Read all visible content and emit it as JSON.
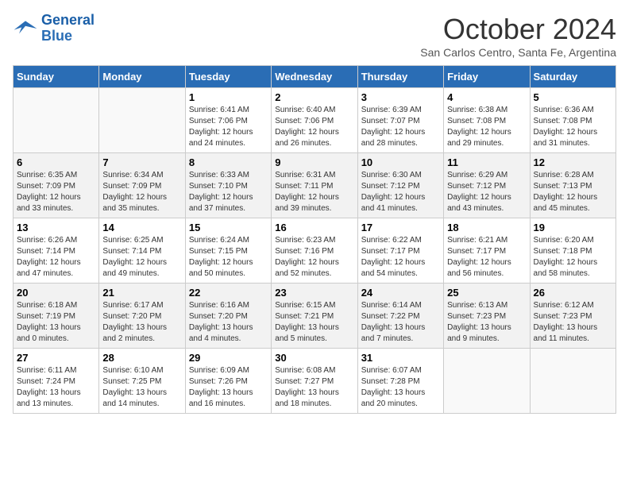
{
  "header": {
    "logo_line1": "General",
    "logo_line2": "Blue",
    "month_title": "October 2024",
    "location": "San Carlos Centro, Santa Fe, Argentina"
  },
  "days_of_week": [
    "Sunday",
    "Monday",
    "Tuesday",
    "Wednesday",
    "Thursday",
    "Friday",
    "Saturday"
  ],
  "weeks": [
    [
      {
        "day": "",
        "info": ""
      },
      {
        "day": "",
        "info": ""
      },
      {
        "day": "1",
        "info": "Sunrise: 6:41 AM\nSunset: 7:06 PM\nDaylight: 12 hours and 24 minutes."
      },
      {
        "day": "2",
        "info": "Sunrise: 6:40 AM\nSunset: 7:06 PM\nDaylight: 12 hours and 26 minutes."
      },
      {
        "day": "3",
        "info": "Sunrise: 6:39 AM\nSunset: 7:07 PM\nDaylight: 12 hours and 28 minutes."
      },
      {
        "day": "4",
        "info": "Sunrise: 6:38 AM\nSunset: 7:08 PM\nDaylight: 12 hours and 29 minutes."
      },
      {
        "day": "5",
        "info": "Sunrise: 6:36 AM\nSunset: 7:08 PM\nDaylight: 12 hours and 31 minutes."
      }
    ],
    [
      {
        "day": "6",
        "info": "Sunrise: 6:35 AM\nSunset: 7:09 PM\nDaylight: 12 hours and 33 minutes."
      },
      {
        "day": "7",
        "info": "Sunrise: 6:34 AM\nSunset: 7:09 PM\nDaylight: 12 hours and 35 minutes."
      },
      {
        "day": "8",
        "info": "Sunrise: 6:33 AM\nSunset: 7:10 PM\nDaylight: 12 hours and 37 minutes."
      },
      {
        "day": "9",
        "info": "Sunrise: 6:31 AM\nSunset: 7:11 PM\nDaylight: 12 hours and 39 minutes."
      },
      {
        "day": "10",
        "info": "Sunrise: 6:30 AM\nSunset: 7:12 PM\nDaylight: 12 hours and 41 minutes."
      },
      {
        "day": "11",
        "info": "Sunrise: 6:29 AM\nSunset: 7:12 PM\nDaylight: 12 hours and 43 minutes."
      },
      {
        "day": "12",
        "info": "Sunrise: 6:28 AM\nSunset: 7:13 PM\nDaylight: 12 hours and 45 minutes."
      }
    ],
    [
      {
        "day": "13",
        "info": "Sunrise: 6:26 AM\nSunset: 7:14 PM\nDaylight: 12 hours and 47 minutes."
      },
      {
        "day": "14",
        "info": "Sunrise: 6:25 AM\nSunset: 7:14 PM\nDaylight: 12 hours and 49 minutes."
      },
      {
        "day": "15",
        "info": "Sunrise: 6:24 AM\nSunset: 7:15 PM\nDaylight: 12 hours and 50 minutes."
      },
      {
        "day": "16",
        "info": "Sunrise: 6:23 AM\nSunset: 7:16 PM\nDaylight: 12 hours and 52 minutes."
      },
      {
        "day": "17",
        "info": "Sunrise: 6:22 AM\nSunset: 7:17 PM\nDaylight: 12 hours and 54 minutes."
      },
      {
        "day": "18",
        "info": "Sunrise: 6:21 AM\nSunset: 7:17 PM\nDaylight: 12 hours and 56 minutes."
      },
      {
        "day": "19",
        "info": "Sunrise: 6:20 AM\nSunset: 7:18 PM\nDaylight: 12 hours and 58 minutes."
      }
    ],
    [
      {
        "day": "20",
        "info": "Sunrise: 6:18 AM\nSunset: 7:19 PM\nDaylight: 13 hours and 0 minutes."
      },
      {
        "day": "21",
        "info": "Sunrise: 6:17 AM\nSunset: 7:20 PM\nDaylight: 13 hours and 2 minutes."
      },
      {
        "day": "22",
        "info": "Sunrise: 6:16 AM\nSunset: 7:20 PM\nDaylight: 13 hours and 4 minutes."
      },
      {
        "day": "23",
        "info": "Sunrise: 6:15 AM\nSunset: 7:21 PM\nDaylight: 13 hours and 5 minutes."
      },
      {
        "day": "24",
        "info": "Sunrise: 6:14 AM\nSunset: 7:22 PM\nDaylight: 13 hours and 7 minutes."
      },
      {
        "day": "25",
        "info": "Sunrise: 6:13 AM\nSunset: 7:23 PM\nDaylight: 13 hours and 9 minutes."
      },
      {
        "day": "26",
        "info": "Sunrise: 6:12 AM\nSunset: 7:23 PM\nDaylight: 13 hours and 11 minutes."
      }
    ],
    [
      {
        "day": "27",
        "info": "Sunrise: 6:11 AM\nSunset: 7:24 PM\nDaylight: 13 hours and 13 minutes."
      },
      {
        "day": "28",
        "info": "Sunrise: 6:10 AM\nSunset: 7:25 PM\nDaylight: 13 hours and 14 minutes."
      },
      {
        "day": "29",
        "info": "Sunrise: 6:09 AM\nSunset: 7:26 PM\nDaylight: 13 hours and 16 minutes."
      },
      {
        "day": "30",
        "info": "Sunrise: 6:08 AM\nSunset: 7:27 PM\nDaylight: 13 hours and 18 minutes."
      },
      {
        "day": "31",
        "info": "Sunrise: 6:07 AM\nSunset: 7:28 PM\nDaylight: 13 hours and 20 minutes."
      },
      {
        "day": "",
        "info": ""
      },
      {
        "day": "",
        "info": ""
      }
    ]
  ]
}
